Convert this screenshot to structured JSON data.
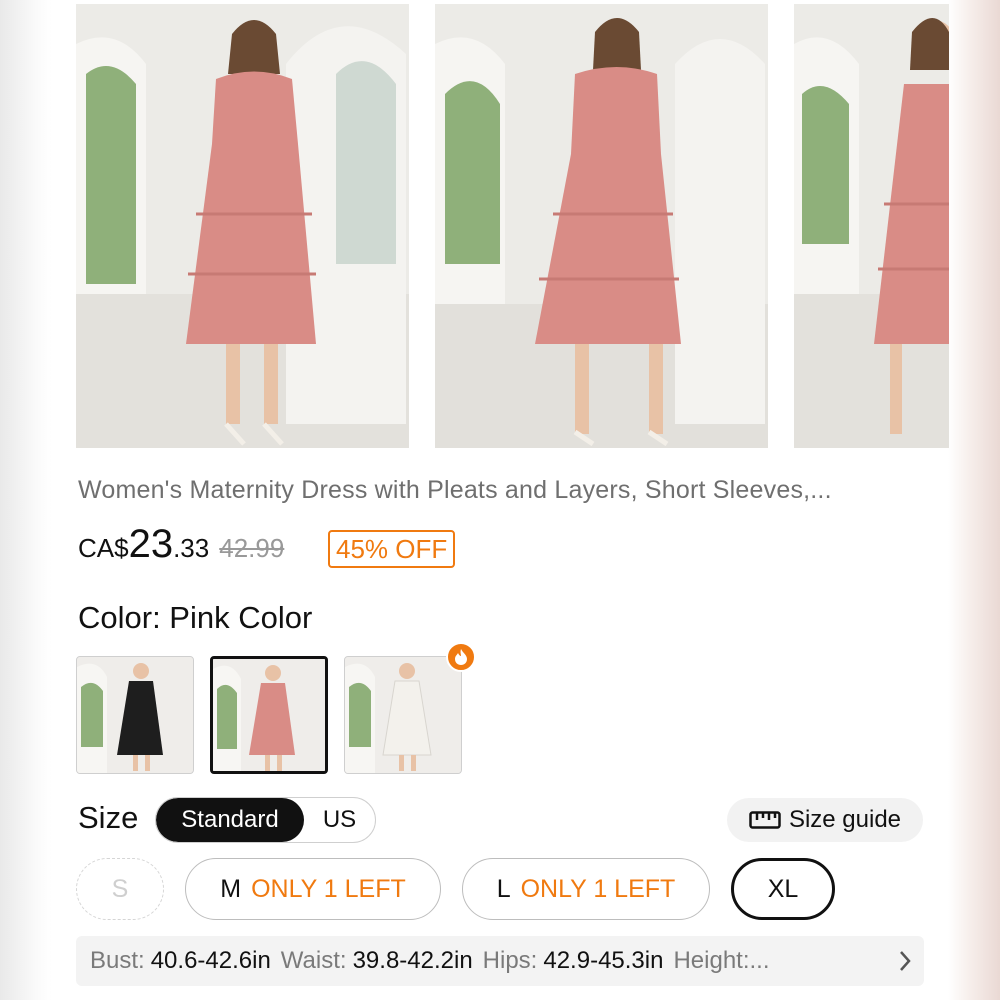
{
  "product": {
    "title": "Women's Maternity Dress with Pleats and Layers, Short Sleeves,...",
    "price_currency": "CA$",
    "price_int": "23",
    "price_dec": ".33",
    "original_price": "42.99",
    "discount": "45% OFF"
  },
  "gallery": {
    "images": [
      {
        "icon": "model-front-photo"
      },
      {
        "icon": "model-back-photo"
      },
      {
        "icon": "model-side-photo"
      }
    ]
  },
  "color": {
    "label": "Color: Pink Color",
    "swatches": [
      {
        "name": "black-dress-swatch",
        "color": "#1e1e1e",
        "selected": false
      },
      {
        "name": "pink-dress-swatch",
        "color": "#d98c86",
        "selected": true
      },
      {
        "name": "white-dress-swatch",
        "color": "#f3f1ec",
        "selected": false
      }
    ],
    "hot_icon": "flame-icon"
  },
  "size": {
    "label": "Size",
    "toggle": [
      "Standard",
      "US"
    ],
    "guide_label": "Size guide",
    "options": [
      {
        "label": "S",
        "stock": "",
        "state": "disabled"
      },
      {
        "label": "M",
        "stock": "ONLY 1 LEFT",
        "state": "normal"
      },
      {
        "label": "L",
        "stock": "ONLY 1 LEFT",
        "state": "normal"
      },
      {
        "label": "XL",
        "stock": "",
        "state": "selected"
      }
    ]
  },
  "measurements": {
    "bust_key": "Bust:",
    "bust_val": "40.6-42.6in",
    "waist_key": "Waist:",
    "waist_val": "39.8-42.2in",
    "hips_key": "Hips:",
    "hips_val": "42.9-45.3in",
    "height_key": "Height:..."
  },
  "colors": {
    "accent": "#f07a10",
    "dress": "#d98c86"
  }
}
